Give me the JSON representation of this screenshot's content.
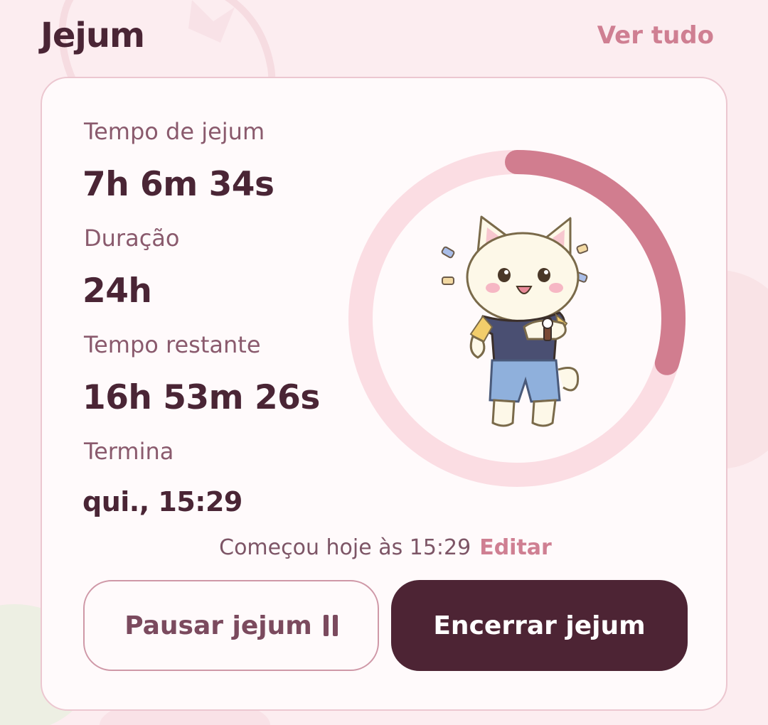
{
  "header": {
    "title": "Jejum",
    "view_all": "Ver tudo"
  },
  "fast": {
    "elapsed_label": "Tempo de jejum",
    "elapsed_value": "7h 6m 34s",
    "duration_label": "Duração",
    "duration_value": "24h",
    "remaining_label": "Tempo restante",
    "remaining_value": "16h 53m 26s",
    "ends_label": "Termina",
    "ends_value": "qui., 15:29",
    "progress": 0.296,
    "started_text": "Começou hoje às 15:29",
    "edit_label": "Editar"
  },
  "buttons": {
    "pause_label": "Pausar jejum",
    "end_label": "Encerrar jejum"
  },
  "icons": {
    "mascot": "cat-checking-watch-icon",
    "pause": "pause-icon"
  },
  "colors": {
    "background": "#fcedf0",
    "accent": "#cf7f92",
    "ring_track": "#fbdde3",
    "ring_progress": "#d17d8f",
    "primary_dark": "#4d2434",
    "text_dark": "#4a2535"
  }
}
